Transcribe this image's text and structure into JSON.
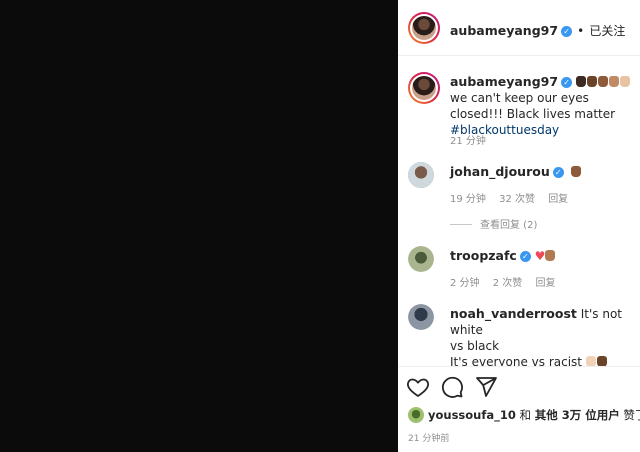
{
  "post": {
    "media_color": "#0c0b0b",
    "author": "aubameyang97",
    "follow_status": "已关注",
    "dot": "•"
  },
  "caption": {
    "username": "aubameyang97",
    "text": "we can't keep our eyes closed!!! Black lives matter",
    "hashtag": "#blackouttuesday",
    "time": "21 分钟"
  },
  "comments": [
    {
      "username": "johan_djourou",
      "time": "19 分钟",
      "likes": "32 次赞",
      "reply": "回复",
      "view_replies": "查看回复 (2)"
    },
    {
      "username": "troopzafc",
      "time": "2 分钟",
      "likes": "2 次赞",
      "reply": "回复"
    },
    {
      "username": "noah_vanderroost",
      "text_line1": "It's not white",
      "text_line2": "vs black",
      "text_line3": "It's everyone vs racist"
    }
  ],
  "likes_line": {
    "user": "youssoufa_10",
    "and": "和",
    "others": "其他 3万 位用户",
    "suffix": "赞了"
  },
  "post_time": "21 分钟前",
  "icons": [
    "heart-icon",
    "comment-icon",
    "share-icon"
  ]
}
